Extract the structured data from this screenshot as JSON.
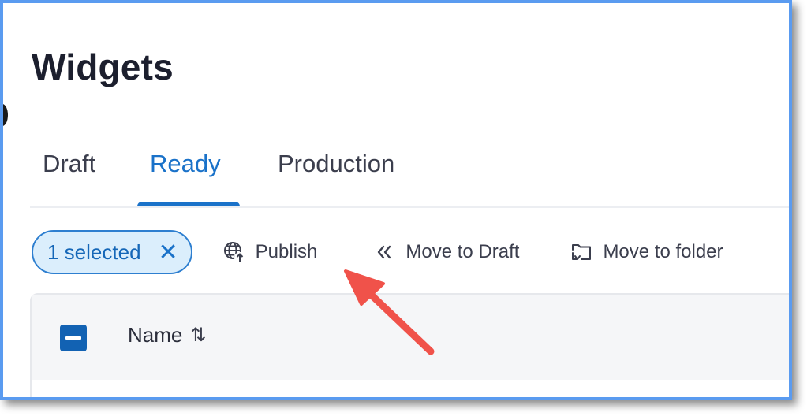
{
  "page": {
    "title": "Widgets"
  },
  "tabs": [
    {
      "label": "Draft",
      "active": false
    },
    {
      "label": "Ready",
      "active": true
    },
    {
      "label": "Production",
      "active": false
    }
  ],
  "toolbar": {
    "selected_label": "1 selected",
    "clear_icon": "close-icon",
    "actions": [
      {
        "label": "Publish",
        "icon": "globe-upload-icon"
      },
      {
        "label": "Move to Draft",
        "icon": "double-chevron-left-icon"
      },
      {
        "label": "Move to folder",
        "icon": "folder-move-icon"
      }
    ]
  },
  "table": {
    "header_checkbox_state": "indeterminate",
    "columns": [
      {
        "label": "Name",
        "sort_icon": "sort-arrows-icon"
      }
    ]
  },
  "colors": {
    "accent": "#1a72c9",
    "chip_bg": "#dbeefc",
    "checkbox": "#1262b3",
    "annotation_arrow": "#f0524a",
    "frame_border": "#5a9bf0"
  }
}
